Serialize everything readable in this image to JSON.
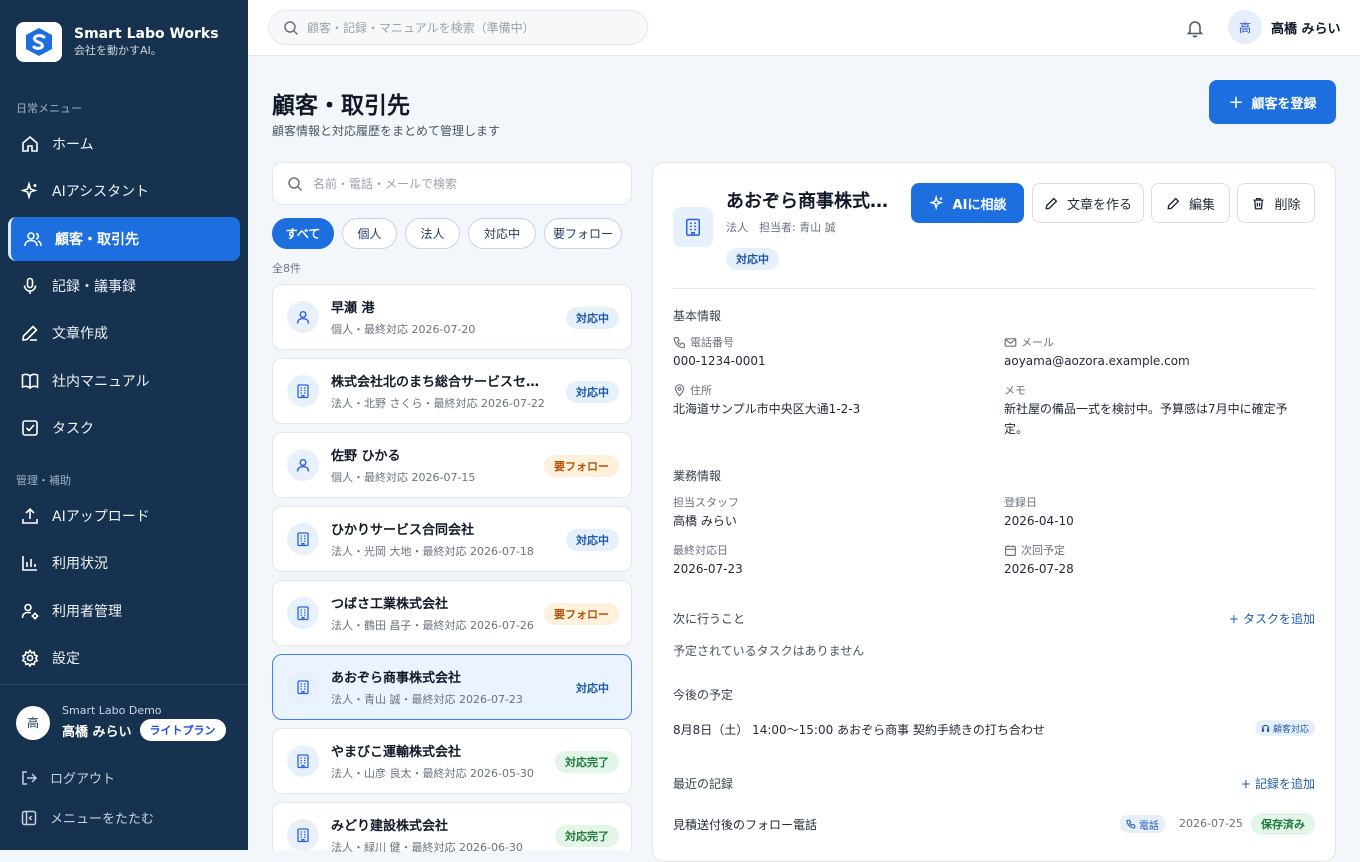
{
  "app": {
    "name": "Smart Labo Works",
    "tagline": "会社を動かすAI。"
  },
  "topbar": {
    "search_placeholder": "顧客・記録・マニュアルを検索（準備中）",
    "user_initial": "高",
    "user_name": "高橋 みらい"
  },
  "sidebar": {
    "section_daily": "日常メニュー",
    "section_admin": "管理・補助",
    "items": [
      {
        "label": "ホーム",
        "icon": "home-icon"
      },
      {
        "label": "AIアシスタント",
        "icon": "sparkle-icon"
      },
      {
        "label": "顧客・取引先",
        "icon": "users-icon",
        "active": true
      },
      {
        "label": "記録・議事録",
        "icon": "mic-icon"
      },
      {
        "label": "文章作成",
        "icon": "pen-icon"
      },
      {
        "label": "社内マニュアル",
        "icon": "book-icon"
      },
      {
        "label": "タスク",
        "icon": "checkbox-icon"
      },
      {
        "label": "AIアップロード",
        "icon": "upload-icon"
      },
      {
        "label": "利用状況",
        "icon": "bar-chart-icon"
      },
      {
        "label": "利用者管理",
        "icon": "user-gear-icon"
      },
      {
        "label": "設定",
        "icon": "gear-icon"
      }
    ],
    "user": {
      "initial": "高",
      "org": "Smart Labo Demo",
      "name": "高橋 みらい",
      "plan": "ライトプラン"
    },
    "logout": "ログアウト",
    "collapse": "メニューをたたむ"
  },
  "page": {
    "title": "顧客・取引先",
    "subtitle": "顧客情報と対応履歴をまとめて管理します",
    "register_button": "顧客を登録"
  },
  "list": {
    "search_placeholder": "名前・電話・メールで検索",
    "filters": [
      "すべて",
      "個人",
      "法人",
      "対応中",
      "要フォロー"
    ],
    "count": "全8件",
    "customers": [
      {
        "name": "早瀬 港",
        "meta": "個人・最終対応 2026-07-20",
        "status": "対応中",
        "type": "person"
      },
      {
        "name": "株式会社北のまち総合サービスセンター",
        "meta": "法人・北野 さくら・最終対応 2026-07-22",
        "status": "対応中",
        "type": "company"
      },
      {
        "name": "佐野 ひかる",
        "meta": "個人・最終対応 2026-07-15",
        "status": "要フォロー",
        "type": "person"
      },
      {
        "name": "ひかりサービス合同会社",
        "meta": "法人・光岡 大地・最終対応 2026-07-18",
        "status": "対応中",
        "type": "company"
      },
      {
        "name": "つばさ工業株式会社",
        "meta": "法人・鶴田 昌子・最終対応 2026-07-26",
        "status": "要フォロー",
        "type": "company"
      },
      {
        "name": "あおぞら商事株式会社",
        "meta": "法人・青山 誠・最終対応 2026-07-23",
        "status": "対応中",
        "type": "company",
        "selected": true
      },
      {
        "name": "やまびこ運輸株式会社",
        "meta": "法人・山彦 良太・最終対応 2026-05-30",
        "status": "対応完了",
        "type": "company"
      },
      {
        "name": "みどり建設株式会社",
        "meta": "法人・緑川 健・最終対応 2026-06-30",
        "status": "対応完了",
        "type": "company"
      }
    ]
  },
  "detail": {
    "name": "あおぞら商事株式会社",
    "meta": "法人　担当者: 青山 誠",
    "status": "対応中",
    "buttons": {
      "ai": "AIに相談",
      "write": "文章を作る",
      "edit": "編集",
      "delete": "削除"
    },
    "basic": {
      "title": "基本情報",
      "phone_label": "電話番号",
      "phone": "000-1234-0001",
      "email_label": "メール",
      "email": "aoyama@aozora.example.com",
      "address_label": "住所",
      "address": "北海道サンプル市中央区大通1-2-3",
      "memo_label": "メモ",
      "memo": "新社屋の備品一式を検討中。予算感は7月中に確定予定。"
    },
    "business": {
      "title": "業務情報",
      "staff_label": "担当スタッフ",
      "staff": "高橋 みらい",
      "registered_label": "登録日",
      "registered": "2026-04-10",
      "last_label": "最終対応日",
      "last": "2026-07-23",
      "next_label": "次回予定",
      "next": "2026-07-28"
    },
    "next_actions": {
      "title": "次に行うこと",
      "add": "タスクを追加",
      "empty": "予定されているタスクはありません"
    },
    "schedule": {
      "title": "今後の予定",
      "item": "8月8日（土） 14:00〜15:00 あおぞら商事 契約手続きの打ち合わせ",
      "tag": "顧客対応"
    },
    "records": {
      "title": "最近の記録",
      "add": "記録を追加",
      "item_title": "見積送付後のフォロー電話",
      "item_tag": "電話",
      "item_date": "2026-07-25",
      "item_status": "保存済み"
    }
  },
  "colors": {
    "sidebar": "#17324f",
    "accent": "#1d6fe0",
    "blue_badge": "#1d5aa8",
    "orange_badge": "#b45309",
    "green_badge": "#1e7b3a"
  }
}
